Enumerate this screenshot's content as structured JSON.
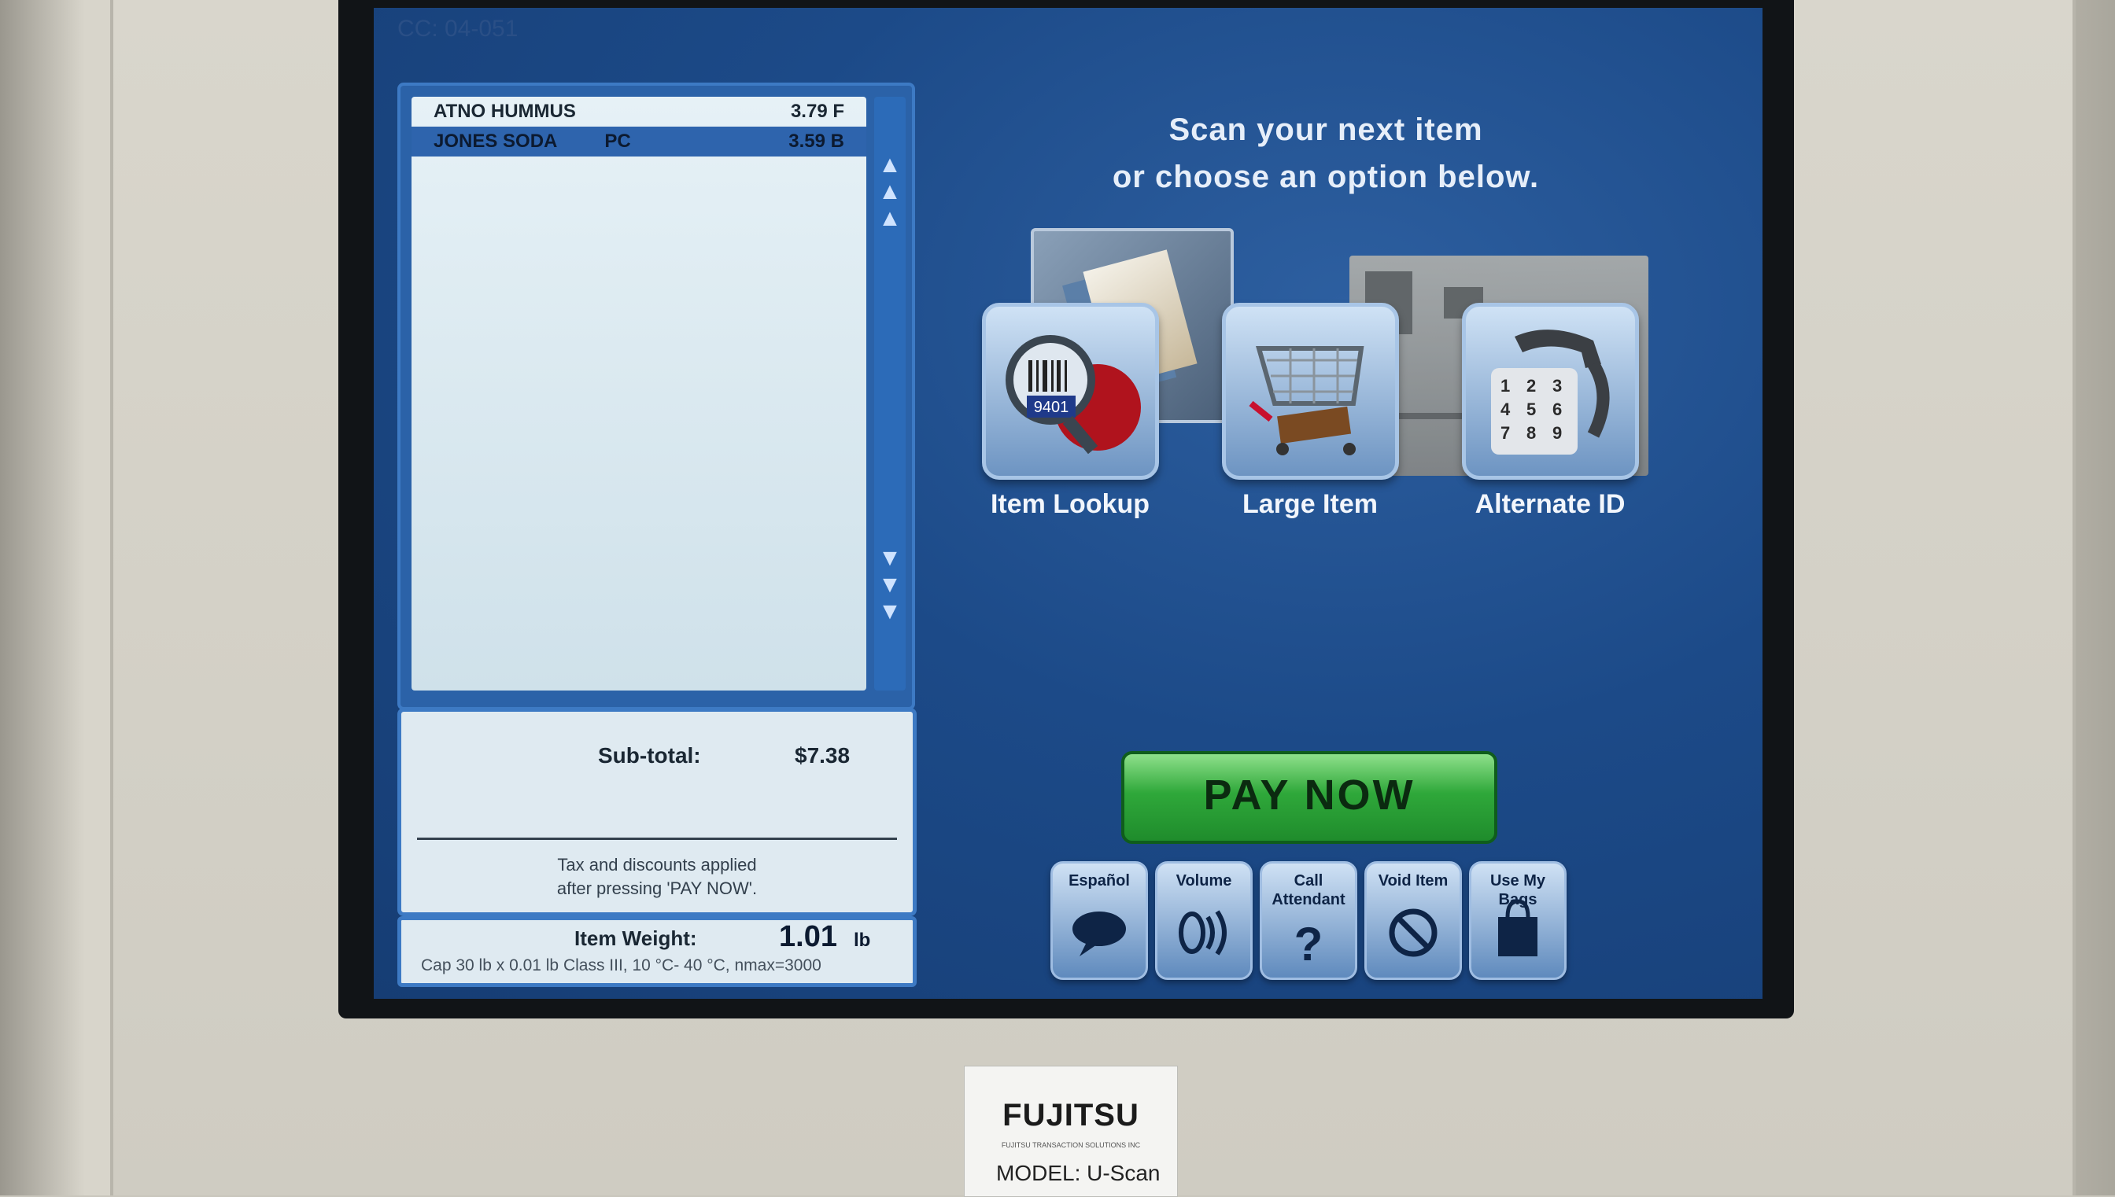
{
  "screen": {
    "corner_code": "CC: 04-051",
    "prompt_line1": "Scan your next item",
    "prompt_line2": "or choose an option below."
  },
  "receipt": {
    "items": [
      {
        "name": "ATNO HUMMUS",
        "flag": "",
        "price": "3.79 F",
        "selected": false
      },
      {
        "name": "JONES SODA",
        "flag": "PC",
        "price": "3.59 B",
        "selected": true
      }
    ]
  },
  "totals": {
    "subtotal_label": "Sub-total:",
    "subtotal_value": "$7.38",
    "tax_note_line1": "Tax and discounts applied",
    "tax_note_line2": "after pressing 'PAY NOW'."
  },
  "scale": {
    "label": "Item Weight:",
    "value": "1.01",
    "unit": "lb",
    "spec": "Cap 30 lb x 0.01 lb Class III, 10 °C- 40 °C, nmax=3000"
  },
  "options": {
    "item_lookup": "Item Lookup",
    "lookup_code": "9401",
    "large_item": "Large Item",
    "alternate_id": "Alternate ID"
  },
  "pay_now": "PAY NOW",
  "bottom_buttons": {
    "espanol": "Español",
    "volume": "Volume",
    "call_attendant": "Call Attendant",
    "void_item": "Void Item",
    "use_my_bags": "Use My Bags"
  },
  "sticker": {
    "brand": "FUJITSU",
    "subtext": "FUJITSU TRANSACTION SOLUTIONS INC",
    "model": "MODEL: U-Scan"
  },
  "colors": {
    "screen_blue": "#1c4a88",
    "pay_green": "#2fa83a",
    "selected_row": "#2e64ad"
  }
}
